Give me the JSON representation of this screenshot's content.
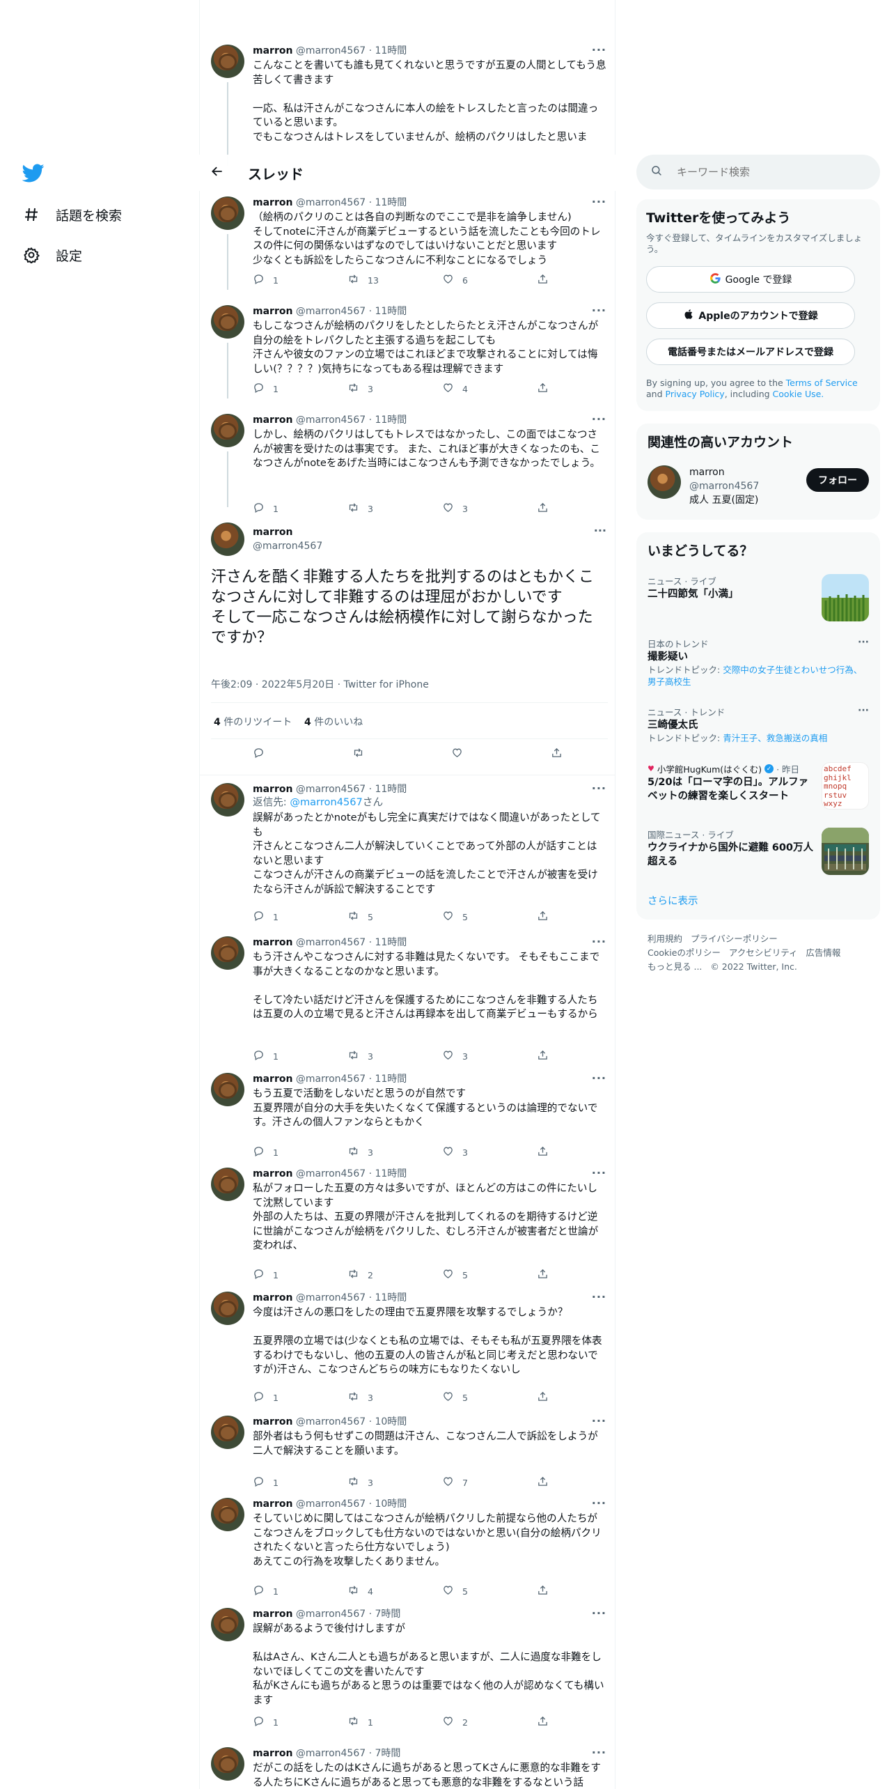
{
  "nav": {
    "explore": "話題を検索",
    "settings": "設定"
  },
  "thread_header": {
    "title": "スレッド"
  },
  "user": {
    "name": "marron",
    "handle": "@marron4567"
  },
  "top_tweet": {
    "meta": "@marron4567 · 11時間",
    "text": "こんなことを書いても誰も見てくれないと思うですが五夏の人間としてもう息苦しくて書きます\n\n一応、私は汗さんがこなつさんに本人の絵をトレスしたと言ったのは間違っていると思います。\nでもこなつさんはトレスをしていませんが、絵柄のパクリはしたと思いま"
  },
  "before_tweets": [
    {
      "meta": "@marron4567 · 11時間",
      "text": "（絵柄のパクリのことは各自の判断なのでここで是非を論争しません)\nそしてnoteに汗さんが商業デビューするという話を流したことも今回のトレスの件に何の関係ないはずなのでしてはいけないことだと思います\n少なくとも訴訟をしたらこなつさんに不利なことになるでしょう",
      "reply": "1",
      "retweet": "13",
      "like": "6"
    },
    {
      "meta": "@marron4567 · 11時間",
      "text": "もしこなつさんが絵柄のパクリをしたとしたらたとえ汗さんがこなつさんが自分の絵をトレパクしたと主張する過ちを起こしても\n汗さんや彼女のファンの立場ではこれほどまで攻撃されることに対しては悔しい(？？？？)気持ちになってもある程は理解できます",
      "reply": "1",
      "retweet": "3",
      "like": "4"
    },
    {
      "meta": "@marron4567 · 11時間",
      "text": "しかし、絵柄のパクリはしてもトレスではなかったし、この面ではこなつさんが被害を受けたのは事実です。 また、これほど事が大きくなったのも、こなつさんがnoteをあげた当時にはこなつさんも予測できなかったでしょう。",
      "reply": "1",
      "retweet": "3",
      "like": "3"
    }
  ],
  "main_tweet": {
    "text": "汗さんを酷く非難する人たちを批判するのはともかくこなつさんに対して非難するのは理屈がおかしいです\nそして一応こなつさんは絵柄模作に対して謝らなかったですか？",
    "timestamp": "午後2:09 · 2022年5月20日 · Twitter for iPhone",
    "retweets_count": "4",
    "retweets_label": "件のリツイート",
    "likes_count": "4",
    "likes_label": "件のいいね"
  },
  "replies": [
    {
      "meta": "@marron4567 · 11時間",
      "reply_to_label": "返信先: ",
      "reply_to": "@marron4567",
      "reply_suffix": "さん",
      "text": "誤解があったとかnoteがもし完全に真実だけではなく間違いがあったとしても\n汗さんとこなつさん二人が解決していくことであって外部の人が話すことはないと思います\nこなつさんが汗さんの商業デビューの話を流したことで汗さんが被害を受けたなら汗さんが訴訟で解決することです",
      "reply": "1",
      "retweet": "5",
      "like": "5"
    },
    {
      "meta": "@marron4567 · 11時間",
      "text": "もう汗さんやこなつさんに対する非難は見たくないです。 そもそもここまで事が大きくなることなのかなと思います。\n\nそして冷たい話だけど汗さんを保護するためにこなつさんを非難する人たちは五夏の人の立場で見ると汗さんは再録本を出して商業デビューもするから",
      "reply": "1",
      "retweet": "3",
      "like": "3"
    },
    {
      "meta": "@marron4567 · 11時間",
      "text": "もう五夏で活動をしないだと思うのが自然です\n五夏界隈が自分の大手を失いたくなくて保護するというのは論理的でないです。汗さんの個人ファンならともかく",
      "reply": "1",
      "retweet": "3",
      "like": "3"
    },
    {
      "meta": "@marron4567 · 11時間",
      "text": "私がフォローした五夏の方々は多いですが、ほとんどの方はこの件にたいして沈黙しています\n外部の人たちは、五夏の界隈が汗さんを批判してくれるのを期待するけど逆に世論がこなつさんが絵柄をパクリした、むしろ汗さんが被害者だと世論が変われば、",
      "reply": "1",
      "retweet": "2",
      "like": "5"
    },
    {
      "meta": "@marron4567 · 11時間",
      "text": "今度は汗さんの悪口をしたの理由で五夏界隈を攻撃するでしょうか？\n\n五夏界隈の立場では(少なくとも私の立場では、そもそも私が五夏界隈を体表するわけでもないし、他の五夏の人の皆さんが私と同じ考えだと思わないですが)汗さん、こなつさんどちらの味方にもなりたくないし",
      "reply": "1",
      "retweet": "3",
      "like": "5"
    },
    {
      "meta": "@marron4567 · 10時間",
      "text": "部外者はもう何もせずこの問題は汗さん、こなつさん二人で訴訟をしようが二人で解決することを願います。",
      "reply": "1",
      "retweet": "3",
      "like": "7"
    },
    {
      "meta": "@marron4567 · 10時間",
      "text": "そしていじめに関してはこなつさんが絵柄パクリした前提なら他の人たちがこなつさんをブロックしても仕方ないのではないかと思い(自分の絵柄パクリされたくないと言ったら仕方ないでしょう)\nあえてこの行為を攻撃したくありません。",
      "reply": "1",
      "retweet": "4",
      "like": "5"
    },
    {
      "meta": "@marron4567 · 7時間",
      "text": "誤解があるようで後付けしますが\n\n私はAさん、Kさん二人とも過ちがあると思いますが、二人に過度な非難をしないでほしくてこの文を書いたんです\n私がKさんにも過ちがあると思うのは重要ではなく他の人が認めなくても構います",
      "reply": "1",
      "retweet": "1",
      "like": "2"
    },
    {
      "meta": "@marron4567 · 7時間",
      "text": "だがこの話をしたのはKさんに過ちがあると思ってKさんに悪意的な非難をする人たちにKさんに過ちがあると思っても悪意的な非難をするなという話",
      "reply": "",
      "retweet": "",
      "like": ""
    }
  ],
  "search": {
    "placeholder": "キーワード検索"
  },
  "signup": {
    "title": "Twitterを使ってみよう",
    "subtitle": "今すぐ登録して、タイムラインをカスタマイズしましょう。",
    "google": "Google で登録",
    "apple": "Appleのアカウントで登録",
    "phone": "電話番号またはメールアドレスで登録",
    "terms_pre": "By signing up, you agree to the ",
    "terms": "Terms of Service",
    "and": " and ",
    "privacy": "Privacy Policy",
    "including": ", including ",
    "cookie": "Cookie Use."
  },
  "relevant": {
    "title": "関連性の高いアカウント",
    "name": "marron",
    "handle": "@marron4567",
    "bio": "成人 五夏(固定)",
    "follow": "フォロー"
  },
  "trends": {
    "title": "いまどうしてる？",
    "items": [
      {
        "cat": "ニュース · ライブ",
        "name": "二十四節気「小満」"
      },
      {
        "cat": "日本のトレンド",
        "name": "撮影疑い",
        "sub_label": "トレンドトピック: ",
        "sub_link": "交際中の女子生徒とわいせつ行為、男子高校生"
      },
      {
        "cat": "ニュース · トレンド",
        "name": "三崎優太氏",
        "sub_label": "トレンドトピック: ",
        "sub_link": "青汁王子、救急搬送の真相"
      },
      {
        "cat_account": "小学館HugKum(はぐくむ)",
        "cat_time": "· 昨日",
        "name": "5/20は「ローマ字の日」。アルファベットの練習を楽しくスタート"
      },
      {
        "cat": "国際ニュース · ライブ",
        "name": "ウクライナから国外に避難 600万人超える"
      }
    ],
    "more": "さらに表示",
    "thumb3_text": "abcdef\nghijkl\nmnopq\nrstuv\nwxyz"
  },
  "footer": {
    "l1": "利用規約",
    "l2": "プライバシーポリシー",
    "l3": "Cookieのポリシー",
    "l4": "アクセシビリティ",
    "l5": "広告情報",
    "l6": "もっと見る ...",
    "copy": "© 2022 Twitter, Inc."
  }
}
